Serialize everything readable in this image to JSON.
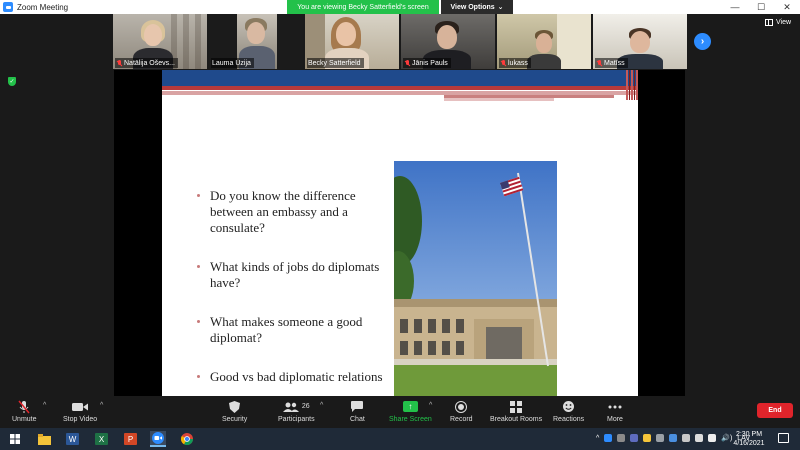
{
  "window": {
    "title": "Zoom Meeting",
    "controls": [
      "—",
      "☐",
      "✕"
    ]
  },
  "banner": {
    "viewing_text": "You are viewing Becky Satterfield's screen",
    "view_options_label": "View Options",
    "view_options_caret": "⌄"
  },
  "participants_strip": [
    {
      "name": "Natālija Oševska",
      "display": "Natālija Oševs...",
      "muted": true
    },
    {
      "name": "Lauma Uzija",
      "display": "Lauma Uzija",
      "muted": false
    },
    {
      "name": "Becky Satterfield",
      "display": "Becky Satterfield",
      "muted": false,
      "active": true
    },
    {
      "name": "Jānis Pauls",
      "display": "Jānis Pauls",
      "muted": true
    },
    {
      "name": "lukass",
      "display": "lukass",
      "muted": true
    },
    {
      "name": "Matīss",
      "display": "Matīss",
      "muted": true
    }
  ],
  "strip_next": "›",
  "view_button": {
    "label": "View"
  },
  "shield": "✓",
  "slide": {
    "bullets": [
      "Do you know the difference between an embassy and a consulate?",
      "What kinds of jobs do diplomats have?",
      "What makes someone a good diplomat?",
      "Good vs bad diplomatic relations"
    ]
  },
  "toolbar": {
    "unmute": "Unmute",
    "stop_video": "Stop Video",
    "security": "Security",
    "participants": "Participants",
    "participants_count": "26",
    "chat": "Chat",
    "share_screen": "Share Screen",
    "record": "Record",
    "breakout_rooms": "Breakout Rooms",
    "reactions": "Reactions",
    "more": "More",
    "end": "End",
    "caret": "^"
  },
  "taskbar": {
    "language": "LAV",
    "time": "2:30 PM",
    "date": "4/16/2021",
    "tray_chevron": "^",
    "volume": "🔊)"
  },
  "colors": {
    "zoom_blue": "#2d8cff",
    "banner_green": "#23c14a",
    "end_red": "#e0242b",
    "slide_blue": "#1f4a8c",
    "slide_red": "#b73a3a"
  }
}
